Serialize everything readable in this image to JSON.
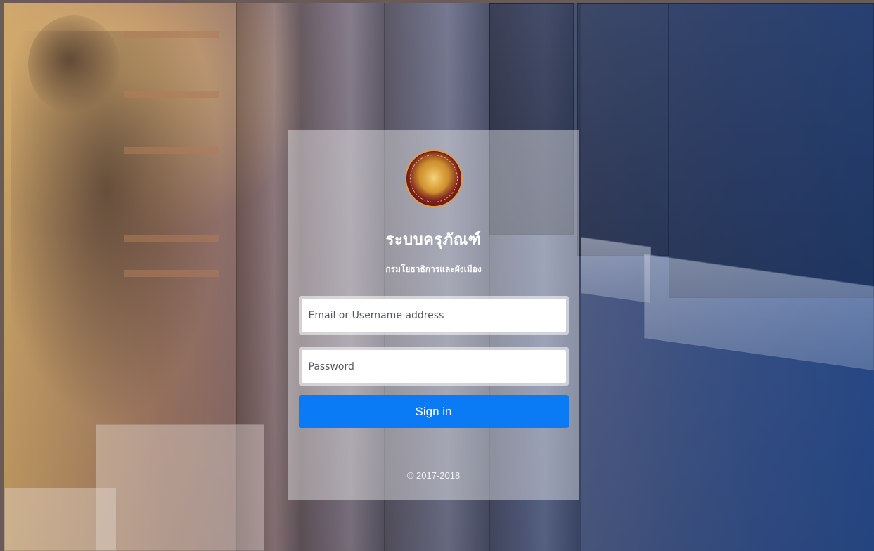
{
  "login": {
    "title": "ระบบครุภัณฑ์",
    "subtitle": "กรมโยธาธิการและผังเมือง",
    "email_placeholder": "Email or Username address",
    "password_placeholder": "Password",
    "signin_label": "Sign in",
    "copyright": "© 2017-2018"
  },
  "colors": {
    "signin_button": "#0b7bf5",
    "card_background": "rgba(255,255,255,0.40)",
    "title_text": "#ffffff"
  },
  "icons": {
    "logo": "department-seal-icon"
  }
}
